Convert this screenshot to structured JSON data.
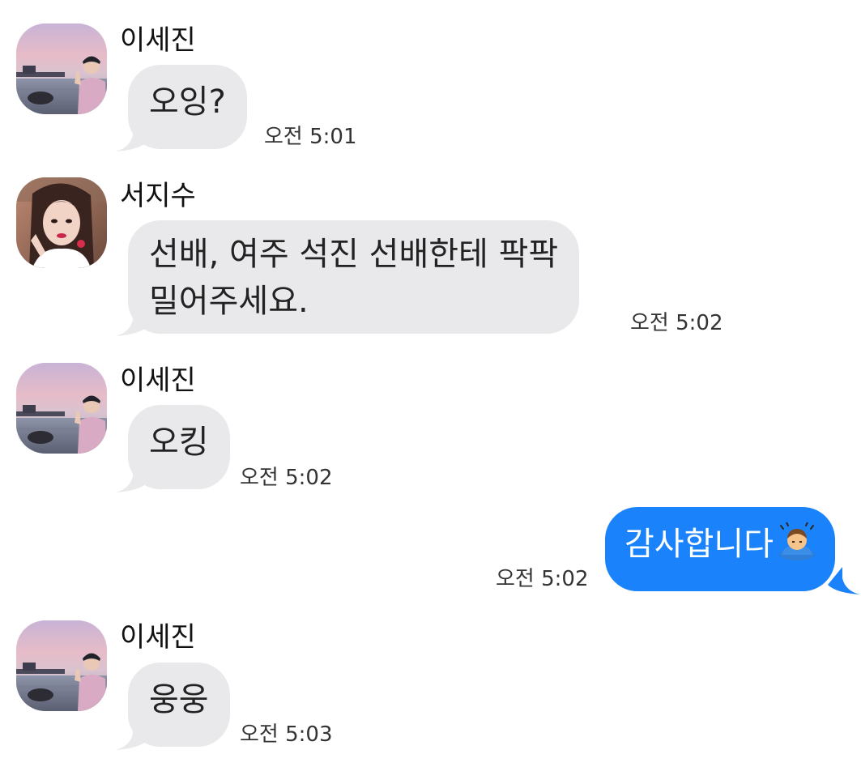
{
  "messages": [
    {
      "direction": "incoming",
      "sender": "이세진",
      "avatar": "avatar-sejin",
      "text": "오잉?",
      "time": "오전 5:01"
    },
    {
      "direction": "incoming",
      "sender": "서지수",
      "avatar": "avatar-jisu",
      "lines": [
        "선배, 여주 석진 선배한테 팍팍",
        "밀어주세요."
      ],
      "time": "오전 5:02"
    },
    {
      "direction": "incoming",
      "sender": "이세진",
      "avatar": "avatar-sejin",
      "text": "오킹",
      "time": "오전 5:02"
    },
    {
      "direction": "outgoing",
      "text": "감사합니다",
      "emoji": "bowing-person-icon",
      "time": "오전 5:02"
    },
    {
      "direction": "incoming",
      "sender": "이세진",
      "avatar": "avatar-sejin",
      "text": "웅웅",
      "time": "오전 5:03"
    }
  ],
  "colors": {
    "incoming_bubble": "#e9e9eb",
    "outgoing_bubble": "#1a82fb",
    "outgoing_text": "#ffffff"
  }
}
